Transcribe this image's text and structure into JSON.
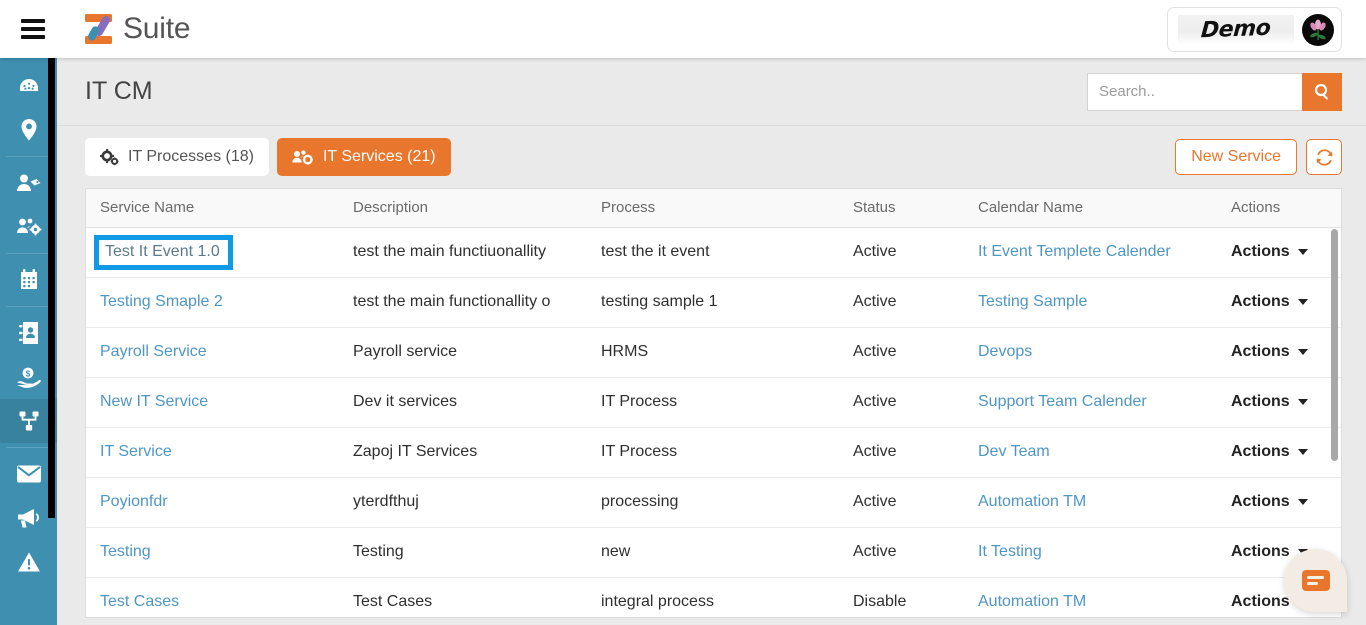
{
  "header": {
    "menu_icon": "hamburger-icon",
    "brand": "Suite",
    "logo_icon": "z-logo-icon",
    "account": {
      "org_logo_text": "Demo",
      "avatar_icon": "flower-avatar-icon"
    }
  },
  "sidebar": {
    "items": [
      {
        "icon": "dashboard-icon",
        "name": "sidebar-item-dashboard",
        "active": false
      },
      {
        "icon": "location-pin-icon",
        "name": "sidebar-item-locations",
        "active": false
      },
      {
        "icon": "user-tag-icon",
        "name": "sidebar-item-customers",
        "active": false
      },
      {
        "icon": "users-cog-icon",
        "name": "sidebar-item-teams",
        "active": false
      },
      {
        "icon": "calendar-icon",
        "name": "sidebar-item-calendar",
        "active": false
      },
      {
        "icon": "address-book-icon",
        "name": "sidebar-item-contacts",
        "active": false
      },
      {
        "icon": "hand-holding-dollar-icon",
        "name": "sidebar-item-billing",
        "active": false
      },
      {
        "icon": "sitemap-icon",
        "name": "sidebar-item-itcm",
        "active": true
      },
      {
        "icon": "envelope-icon",
        "name": "sidebar-item-mail",
        "active": false
      },
      {
        "icon": "bullhorn-icon",
        "name": "sidebar-item-announcements",
        "active": false
      },
      {
        "icon": "warning-triangle-icon",
        "name": "sidebar-item-alerts",
        "active": false
      }
    ]
  },
  "page": {
    "title": "IT CM"
  },
  "search": {
    "value": "",
    "placeholder": "Search..",
    "button_icon": "search-icon"
  },
  "tabs": [
    {
      "label": "IT Processes (18)",
      "icon": "cogs-icon",
      "active": false
    },
    {
      "label": "IT Services (21)",
      "icon": "users-cog-icon",
      "active": true
    }
  ],
  "toolbar": {
    "new_service_label": "New Service",
    "refresh_icon": "refresh-icon"
  },
  "table": {
    "columns": [
      "Service Name",
      "Description",
      "Process",
      "Status",
      "Calendar Name",
      "Actions"
    ],
    "action_label": "Actions",
    "rows": [
      {
        "service_name": "Test It Event 1.0",
        "description": "test the main functiuonallity",
        "process": "test the it event",
        "status": "Active",
        "calendar_name": "It Event Templete Calender",
        "selected": true
      },
      {
        "service_name": "Testing Smaple 2",
        "description": "test the main functionallity o",
        "process": "testing sample 1",
        "status": "Active",
        "calendar_name": "Testing Sample",
        "selected": false
      },
      {
        "service_name": "Payroll Service",
        "description": "Payroll service",
        "process": "HRMS",
        "status": "Active",
        "calendar_name": "Devops",
        "selected": false
      },
      {
        "service_name": "New IT Service",
        "description": "Dev it services",
        "process": "IT Process",
        "status": "Active",
        "calendar_name": "Support Team Calender",
        "selected": false
      },
      {
        "service_name": "IT Service",
        "description": "Zapoj IT Services",
        "process": "IT Process",
        "status": "Active",
        "calendar_name": "Dev Team",
        "selected": false
      },
      {
        "service_name": "Poyionfdr",
        "description": "yterdfthuj",
        "process": "processing",
        "status": "Active",
        "calendar_name": "Automation TM",
        "selected": false
      },
      {
        "service_name": "Testing",
        "description": "Testing",
        "process": "new",
        "status": "Active",
        "calendar_name": "It Testing",
        "selected": false
      },
      {
        "service_name": "Test Cases",
        "description": "Test Cases",
        "process": "integral process",
        "status": "Disable",
        "calendar_name": "Automation TM",
        "selected": false
      }
    ]
  },
  "chat": {
    "icon": "chat-bubble-icon"
  },
  "colors": {
    "accent_orange": "#e8762c",
    "sidebar_teal": "#3e8fb0",
    "link_blue": "#4f96c4",
    "highlight_blue": "#109ae6",
    "body_bg": "#eaeaea"
  }
}
